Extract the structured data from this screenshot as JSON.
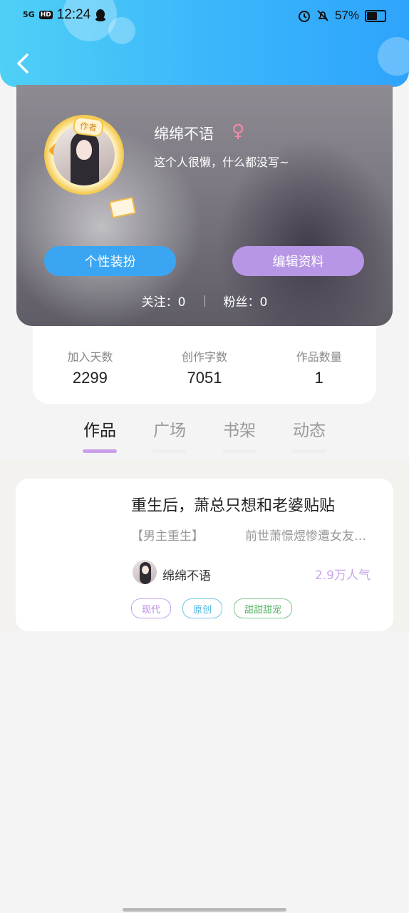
{
  "status_bar": {
    "signal": "5G",
    "hd": "HD",
    "time": "12:24",
    "battery_percent": "57%"
  },
  "profile": {
    "author_badge": "作者",
    "name": "绵绵不语",
    "gender_symbol": "♀",
    "bio": "这个人很懒，什么都没写~",
    "buttons": {
      "dress_up": "个性装扮",
      "edit": "编辑资料"
    },
    "following": "关注：0",
    "followers": "粉丝：0"
  },
  "stats": [
    {
      "label": "加入天数",
      "value": "2299"
    },
    {
      "label": "创作字数",
      "value": "7051"
    },
    {
      "label": "作品数量",
      "value": "1"
    }
  ],
  "tabs": [
    {
      "label": "作品",
      "active": true
    },
    {
      "label": "广场",
      "active": false
    },
    {
      "label": "书架",
      "active": false
    },
    {
      "label": "动态",
      "active": false
    }
  ],
  "work": {
    "title": "重生后，萧总只想和老婆贴贴",
    "tag": "【男主重生】",
    "description": "前世萧憬煜惨遭女友…",
    "author": "绵绵不语",
    "popularity": "2.9万人气",
    "chips": [
      "现代",
      "原创",
      "甜甜甜宠"
    ]
  },
  "colors": {
    "header_start": "#4fd0f6",
    "header_end": "#2ea4fb",
    "dress_button": "#3aa6f3",
    "edit_button": "#b896e6",
    "active_tab_underline": "#c8a0ea",
    "gender": "#f48aa4"
  }
}
